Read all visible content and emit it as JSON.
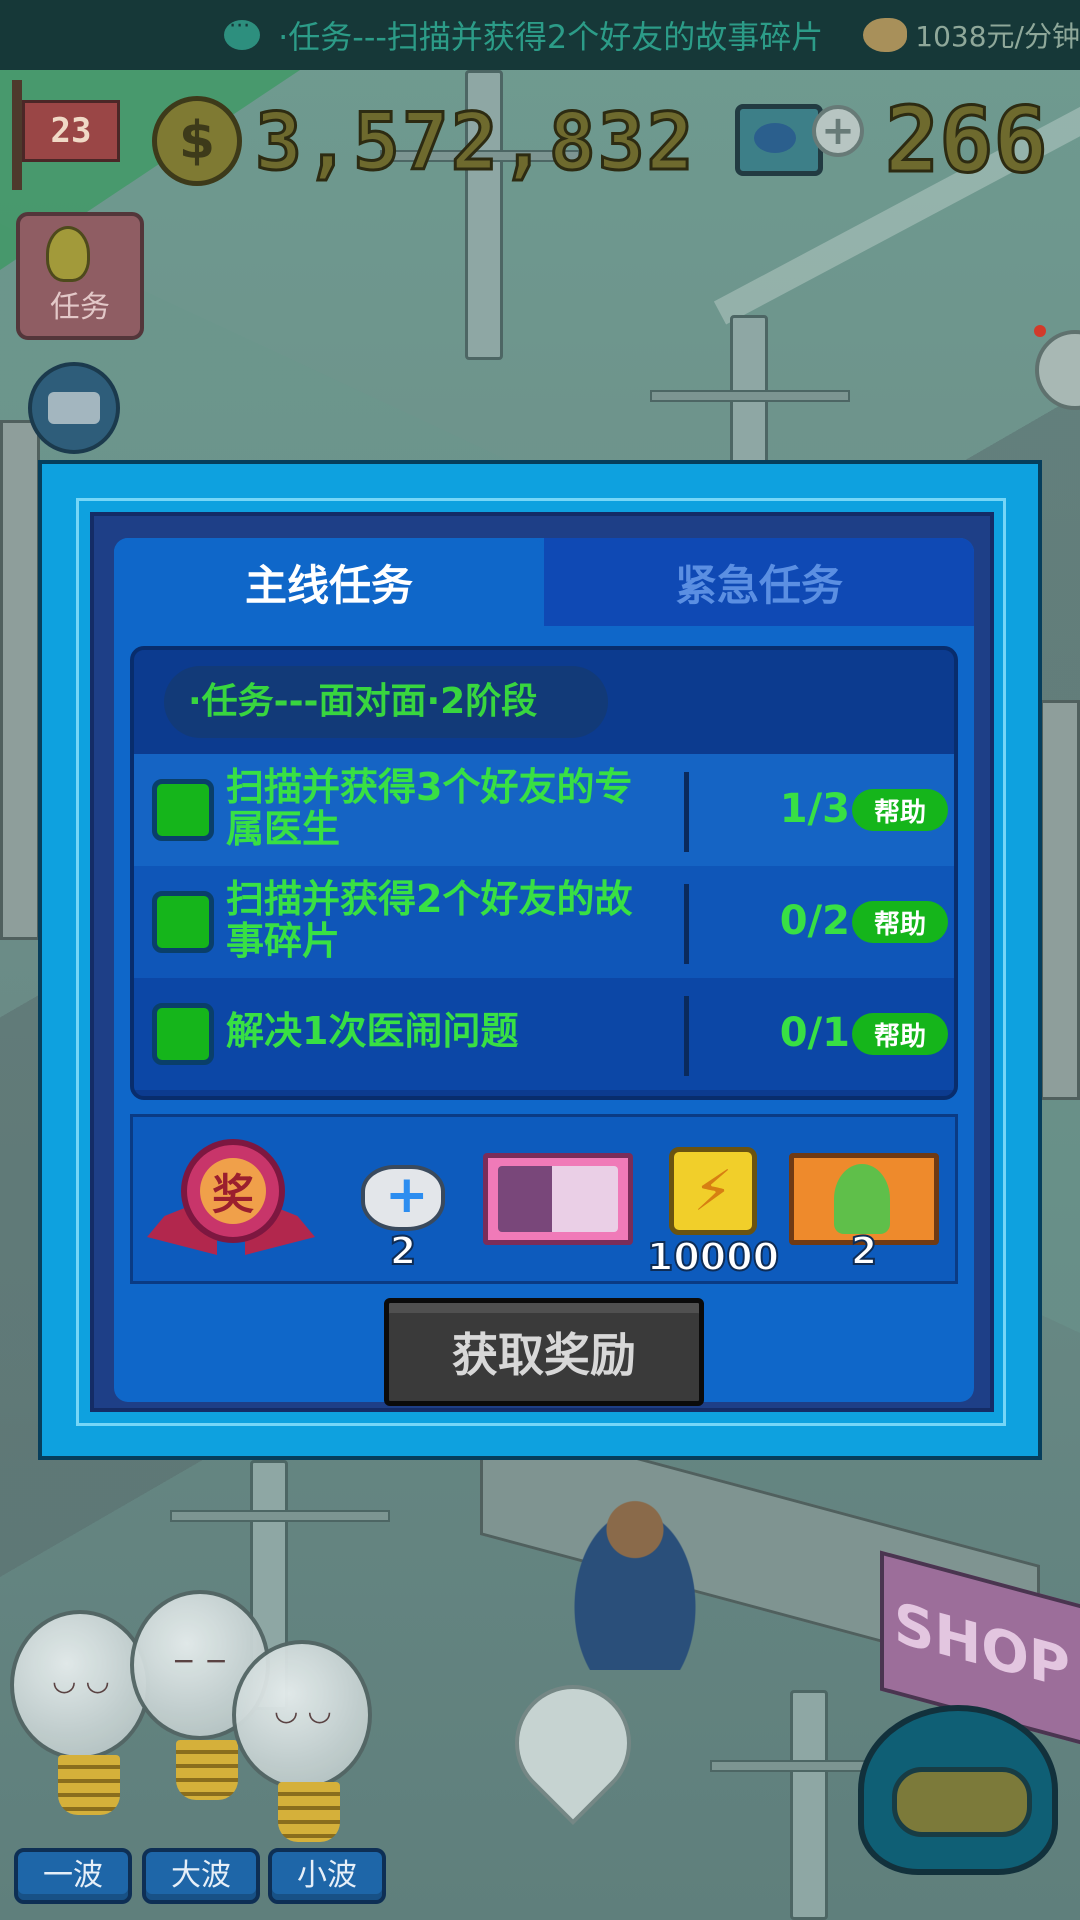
{
  "status_bar": {
    "marquee_text": "·任务---扫描并获得2个好友的故事碎片",
    "income_rate": "1038元/分钟"
  },
  "hud": {
    "level": "23",
    "coins": "3,572,832",
    "gems": "266",
    "task_button_label": "任务"
  },
  "tabs": {
    "main": "主线任务",
    "urgent": "紧急任务",
    "active": "main"
  },
  "task_group": {
    "title": "·任务---面对面·2阶段"
  },
  "tasks": [
    {
      "label": "扫描并获得3个好友的专属医生",
      "progress": "1/3",
      "help_label": "帮助"
    },
    {
      "label": "扫描并获得2个好友的故事碎片",
      "progress": "0/2",
      "help_label": "帮助"
    },
    {
      "label": "解决1次医闹问题",
      "progress": "0/1",
      "help_label": "帮助"
    }
  ],
  "rewards": {
    "medal_text": "奖",
    "items": [
      {
        "icon": "cat-heal-icon",
        "quantity": "2"
      },
      {
        "icon": "doctor-card-icon",
        "quantity": ""
      },
      {
        "icon": "energy-icon",
        "quantity": "10000"
      },
      {
        "icon": "character-card-icon",
        "quantity": "2"
      }
    ]
  },
  "claim_button": "获取奖励",
  "wave_buttons": [
    "一波",
    "大波",
    "小波"
  ],
  "scene": {
    "shop_sign": "SHOP"
  },
  "colors": {
    "modal_frame": "#0ea1df",
    "panel": "#0f67c9",
    "task_text": "#38e044",
    "help_button": "#15b51b",
    "claim_button_disabled": "#3a3a3a"
  }
}
